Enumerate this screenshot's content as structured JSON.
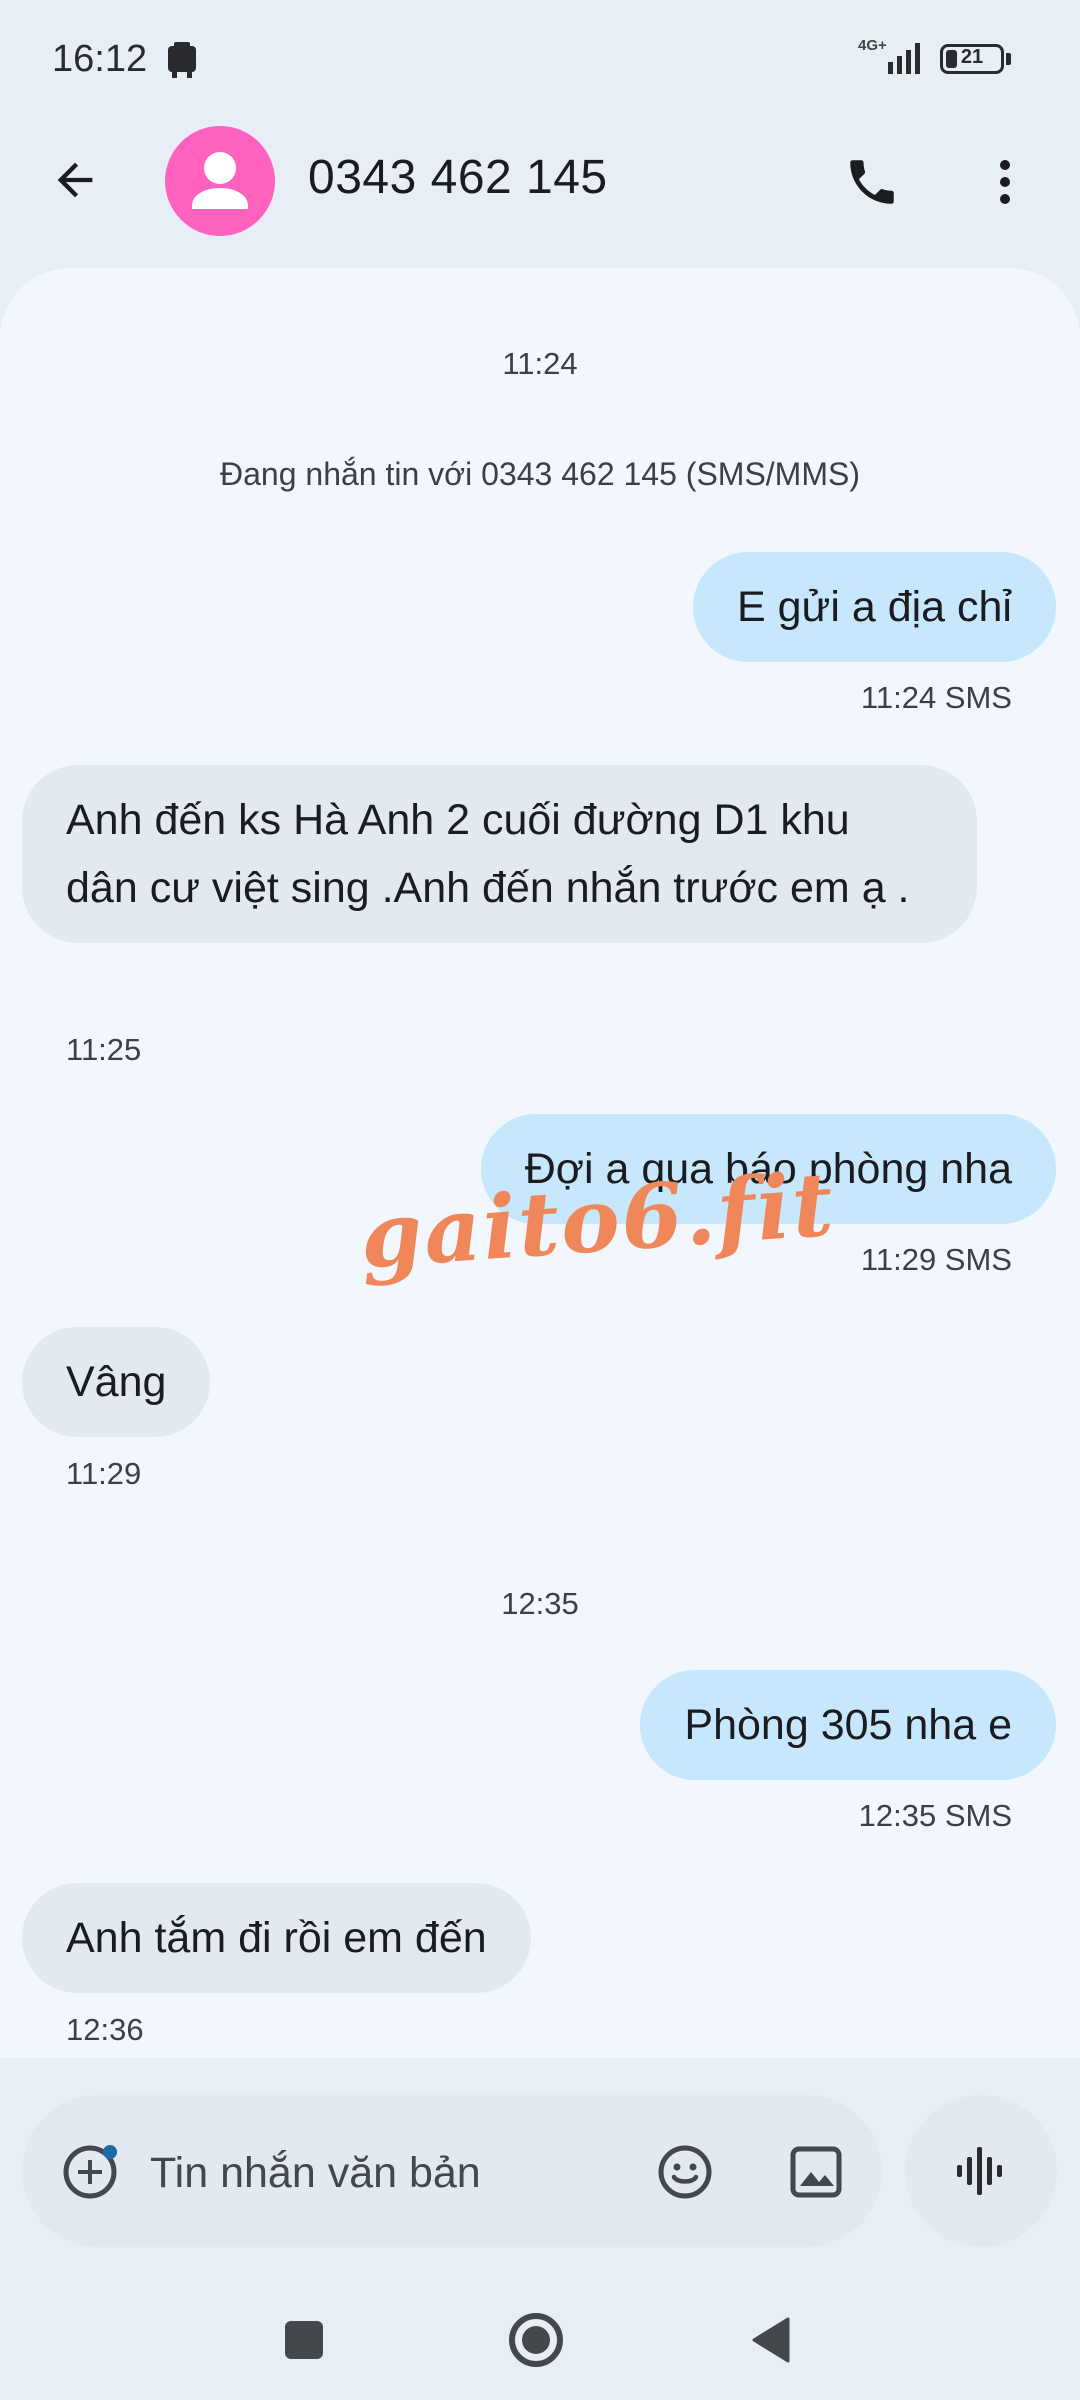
{
  "status_bar": {
    "time": "16:12",
    "network": "4G+",
    "battery": "21",
    "battery_fraction": 0.21,
    "notification_icon": "bag-icon"
  },
  "header": {
    "contact": "0343 462 145",
    "avatar_color": "#ff62be",
    "back_icon": "arrow-left-icon",
    "call_icon": "phone-icon",
    "more_icon": "more-vert-icon"
  },
  "conversation": {
    "ts_1": "11:24",
    "info": "Đang nhắn tin với 0343 462 145 (SMS/MMS)",
    "messages": [
      {
        "text": "E gửi a địa chỉ",
        "meta": "11:24 SMS"
      },
      {
        "text": "Anh đến ks Hà Anh 2 cuối đường D1 khu dân cư việt sing .Anh đến nhắn trước em ạ .",
        "meta": "11:25"
      },
      {
        "text": "Đợi a qua báo phòng nha",
        "meta": "11:29 SMS"
      },
      {
        "text": "Vâng",
        "meta": "11:29"
      },
      {
        "text": "Phòng 305 nha e",
        "meta": "12:35 SMS"
      },
      {
        "text": "Anh tắm đi rồi em đến",
        "meta": "12:36"
      }
    ],
    "ts_2": "12:35",
    "watermark": "gaito6.fit",
    "outgoing_color": "#c7e7fd",
    "incoming_color": "#e3e9f1"
  },
  "compose": {
    "placeholder": "Tin nhắn văn bản",
    "add_icon": "add-circle-icon",
    "emoji_icon": "emoji-icon",
    "image_icon": "image-icon",
    "voice_icon": "waveform-icon"
  },
  "nav": {
    "recents_icon": "square-icon",
    "home_icon": "circle-icon",
    "back_icon": "triangle-back-icon"
  }
}
